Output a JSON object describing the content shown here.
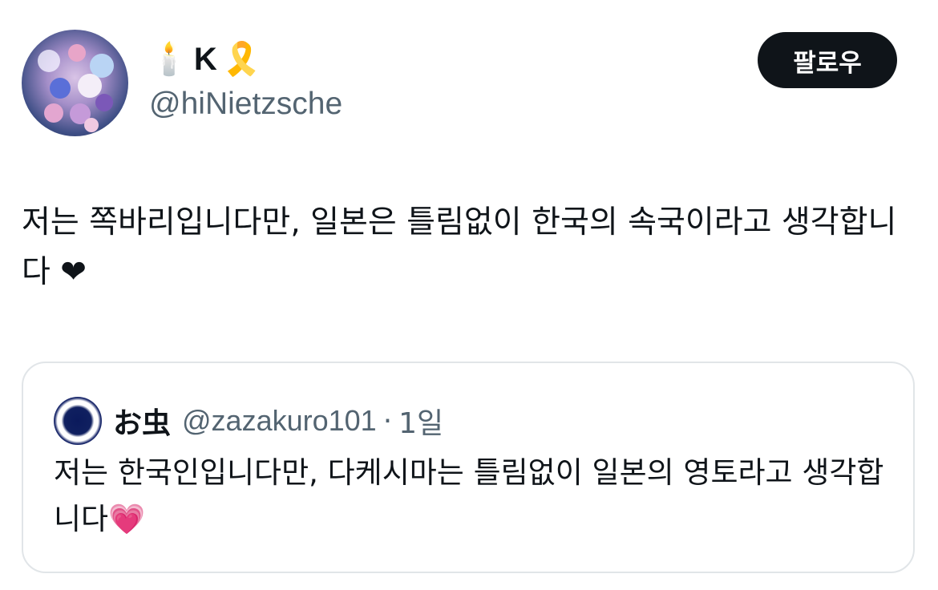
{
  "author": {
    "emoji_prefix": "🕯️",
    "display_name": "K",
    "emoji_suffix": "🎗️",
    "handle": "@hiNietzsche"
  },
  "follow_button": {
    "label": "팔로우"
  },
  "tweet": {
    "text": "저는 쪽바리입니다만, 일본은 틀림없이 한국의 속국이라고 생각합니다 ❤"
  },
  "quoted_tweet": {
    "display_name": "お虫",
    "handle": "@zazakuro101",
    "separator": "·",
    "time": "1일",
    "text": "저는 한국인입니다만, 다케시마는 틀림없이 일본의 영토라고 생각합니다💗"
  }
}
